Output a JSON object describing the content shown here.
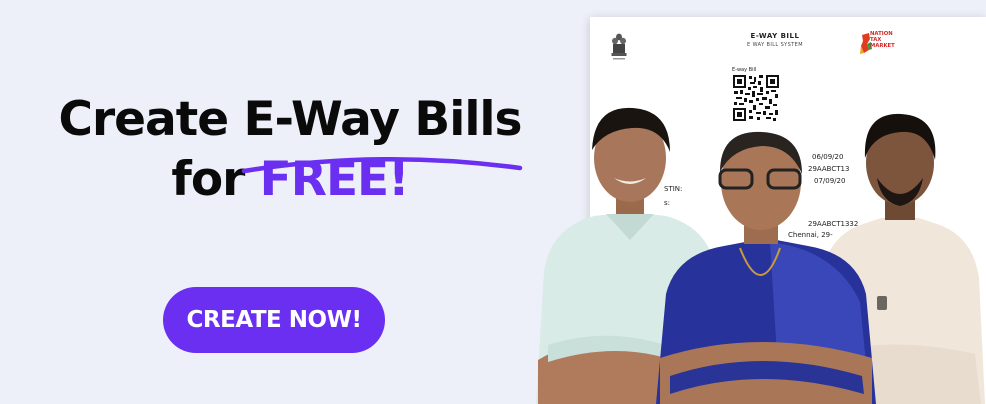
{
  "headline": {
    "line1_prefix": "Create ",
    "line1_highlight": "E-Way Bills",
    "line2_prefix": "for ",
    "line2_highlight": "FREE!"
  },
  "cta": {
    "label": "CREATE NOW!"
  },
  "document": {
    "title": "E-WAY BILL",
    "subtitle": "E WAY BILL SYSTEM",
    "logo_text": [
      "NATION",
      "TAX",
      "MARKET"
    ],
    "qr_label": "E-way Bill",
    "fragments": {
      "gstin_label": "STIN:",
      "colon_label": "s:",
      "date1": "06/09/20",
      "gstin1": "29AABCT13",
      "date2": "07/09/20",
      "gstin2": "29AABCT1332",
      "place": "Chennai, 29-"
    }
  },
  "colors": {
    "background": "#eef0f9",
    "accent": "#6a2ff0",
    "text": "#0a0a0a",
    "button_text": "#ffffff"
  },
  "icons": {
    "emblem": "state-emblem-icon",
    "logo": "nation-tax-market-logo",
    "qr": "qr-code-icon"
  }
}
